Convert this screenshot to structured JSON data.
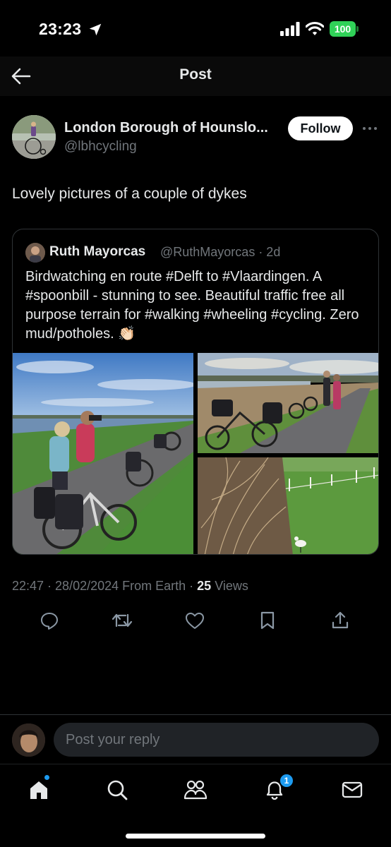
{
  "status_bar": {
    "time": "23:23",
    "battery": "100"
  },
  "header": {
    "title": "Post"
  },
  "post": {
    "author_name": "London Borough of Hounslo...",
    "author_handle": "@lbhcycling",
    "follow_label": "Follow",
    "text": "Lovely pictures of a couple of dykes",
    "meta_prefix": "22:47 · 28/02/2024 From Earth · ",
    "views_count": "25",
    "views_label": " Views"
  },
  "quote": {
    "name": "Ruth Mayorcas",
    "meta": "@RuthMayorcas · 2d",
    "text": "Birdwatching en route #Delft to #Vlaardingen. A #spoonbill - stunning to see. Beautiful traffic free all purpose terrain for #walking #wheeling #cycling. Zero mud/potholes. 👏🏻"
  },
  "reply": {
    "placeholder": "Post your reply"
  },
  "tabbar": {
    "notification_count": "1"
  },
  "colors": {
    "background": "#000000",
    "text_primary": "#e7e9ea",
    "text_secondary": "#71767b",
    "accent": "#1d9bf0",
    "battery": "#30d158"
  },
  "icons": {
    "action_bar": [
      "reply-icon",
      "repost-icon",
      "like-icon",
      "bookmark-icon",
      "share-icon"
    ],
    "tab_bar": [
      "home-icon",
      "search-icon",
      "communities-icon",
      "notifications-icon",
      "messages-icon"
    ]
  }
}
